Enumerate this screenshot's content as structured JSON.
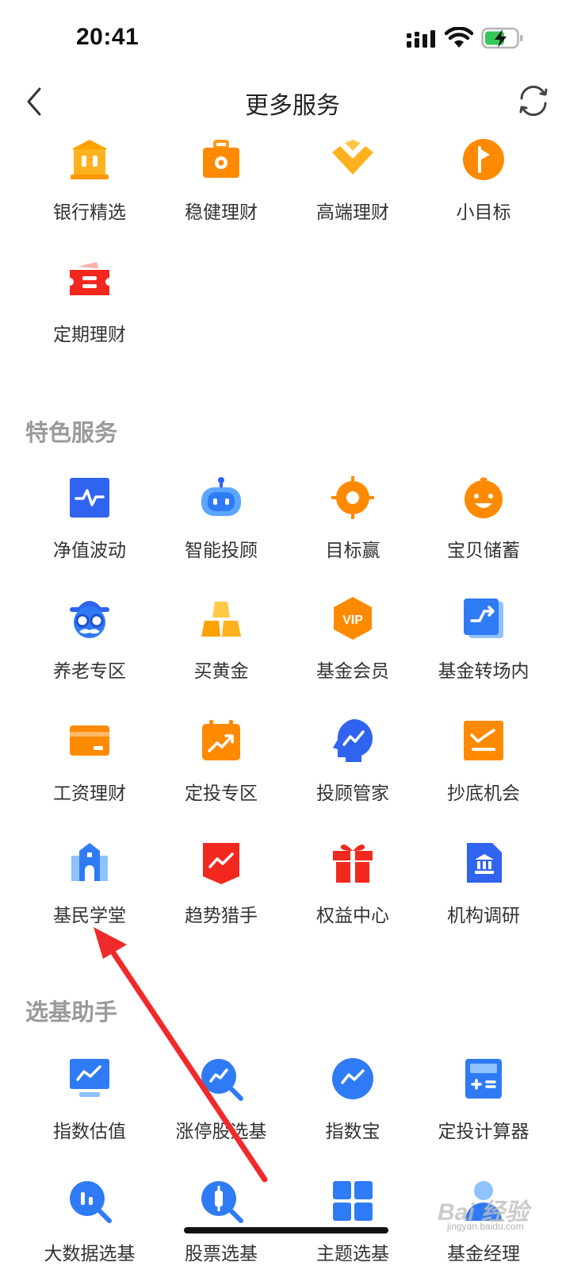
{
  "status_bar": {
    "time": "20:41"
  },
  "header": {
    "title": "更多服务"
  },
  "sections": {
    "top": {
      "items": [
        {
          "label": "银行精选",
          "icon": "bank-icon"
        },
        {
          "label": "稳健理财",
          "icon": "briefcase-icon"
        },
        {
          "label": "高端理财",
          "icon": "diamond-icon"
        },
        {
          "label": "小目标",
          "icon": "flag-icon"
        },
        {
          "label": "定期理财",
          "icon": "ticket-icon"
        }
      ]
    },
    "featured": {
      "title": "特色服务",
      "items": [
        {
          "label": "净值波动",
          "icon": "chart-pulse-icon"
        },
        {
          "label": "智能投顾",
          "icon": "robot-icon"
        },
        {
          "label": "目标赢",
          "icon": "target-icon"
        },
        {
          "label": "宝贝储蓄",
          "icon": "baby-face-icon"
        },
        {
          "label": "养老专区",
          "icon": "grandpa-icon"
        },
        {
          "label": "买黄金",
          "icon": "gold-bars-icon"
        },
        {
          "label": "基金会员",
          "icon": "vip-icon",
          "badge": "VIP"
        },
        {
          "label": "基金转场内",
          "icon": "transfer-icon"
        },
        {
          "label": "工资理财",
          "icon": "card-icon"
        },
        {
          "label": "定投专区",
          "icon": "calendar-trend-icon"
        },
        {
          "label": "投顾管家",
          "icon": "advisor-head-icon"
        },
        {
          "label": "抄底机会",
          "icon": "bottom-chart-icon"
        },
        {
          "label": "基民学堂",
          "icon": "school-icon"
        },
        {
          "label": "趋势猎手",
          "icon": "trend-banner-icon"
        },
        {
          "label": "权益中心",
          "icon": "gift-icon"
        },
        {
          "label": "机构调研",
          "icon": "institution-icon"
        }
      ]
    },
    "helper": {
      "title": "选基助手",
      "items": [
        {
          "label": "指数估值",
          "icon": "monitor-trend-icon"
        },
        {
          "label": "涨停股选基",
          "icon": "search-trend-icon"
        },
        {
          "label": "指数宝",
          "icon": "index-circle-icon"
        },
        {
          "label": "定投计算器",
          "icon": "calculator-icon"
        },
        {
          "label": "大数据选基",
          "icon": "search-bars-icon"
        },
        {
          "label": "股票选基",
          "icon": "search-candle-icon"
        },
        {
          "label": "主题选基",
          "icon": "grid-icon"
        },
        {
          "label": "基金经理",
          "icon": "manager-icon"
        }
      ]
    }
  },
  "watermark": {
    "logo": "Bai 经验",
    "site": "jingyan.baidu.com"
  },
  "colors": {
    "orange": "#FF8A00",
    "blue": "#2F7BF5",
    "red": "#F23030",
    "gray_title": "#9A9A9A",
    "annotation": "#F02A2A"
  }
}
